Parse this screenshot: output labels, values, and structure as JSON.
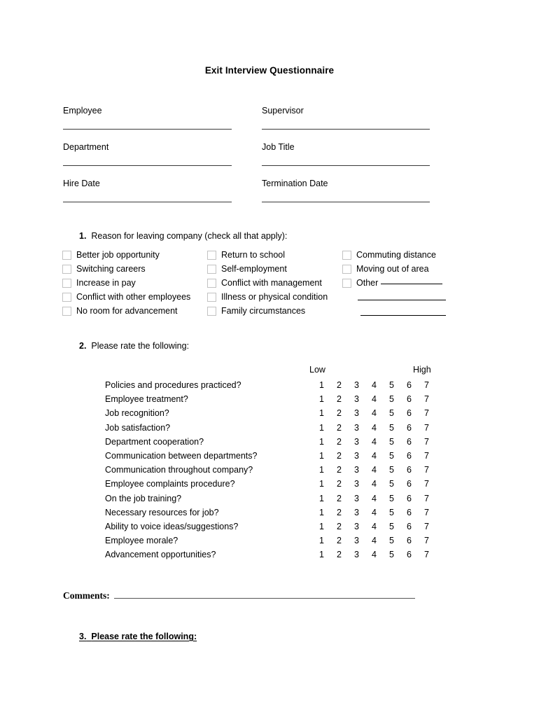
{
  "document": {
    "title": "Exit Interview Questionnaire"
  },
  "header_fields": {
    "left": [
      {
        "label": "Employee"
      },
      {
        "label": "Department"
      },
      {
        "label": "Hire Date"
      }
    ],
    "right": [
      {
        "label": "Supervisor"
      },
      {
        "label": "Job Title"
      },
      {
        "label": "Termination Date"
      }
    ]
  },
  "question1": {
    "number": "1.",
    "text": "Reason for leaving company (check all that apply):",
    "columns": [
      [
        {
          "label": "Better job opportunity"
        },
        {
          "label": "Switching careers"
        },
        {
          "label": "Increase in pay"
        },
        {
          "label": "Conflict with other employees"
        },
        {
          "label": "No room for advancement"
        }
      ],
      [
        {
          "label": "Return to school"
        },
        {
          "label": "Self-employment"
        },
        {
          "label": "Conflict with management"
        },
        {
          "label": "Illness or physical condition"
        },
        {
          "label": "Family circumstances"
        }
      ],
      [
        {
          "label": "Commuting distance"
        },
        {
          "label": "Moving out of area"
        },
        {
          "label": "Other"
        }
      ]
    ]
  },
  "question2": {
    "number": "2.",
    "text": "Please rate the following:",
    "scale_low_label": "Low",
    "scale_high_label": "High",
    "scale_values": [
      "1",
      "2",
      "3",
      "4",
      "5",
      "6",
      "7"
    ],
    "items": [
      {
        "label": "Policies and procedures practiced?"
      },
      {
        "label": "Employee treatment?"
      },
      {
        "label": "Job recognition?"
      },
      {
        "label": "Job satisfaction?"
      },
      {
        "label": "Department cooperation?"
      },
      {
        "label": "Communication between departments?"
      },
      {
        "label": "Communication throughout company?"
      },
      {
        "label": "Employee complaints procedure?"
      },
      {
        "label": "On the job training?"
      },
      {
        "label": "Necessary resources for job?"
      },
      {
        "label": "Ability to voice ideas/suggestions?"
      },
      {
        "label": "Employee morale?"
      },
      {
        "label": "Advancement opportunities?"
      }
    ]
  },
  "comments": {
    "label": "Comments:"
  },
  "question3": {
    "number": "3.",
    "text": "Please rate the following:"
  },
  "colors": {
    "text": "#000000",
    "rule": "#3a3a3a",
    "checkbox_border": "#c2c2c2",
    "page_background": "#ffffff"
  }
}
